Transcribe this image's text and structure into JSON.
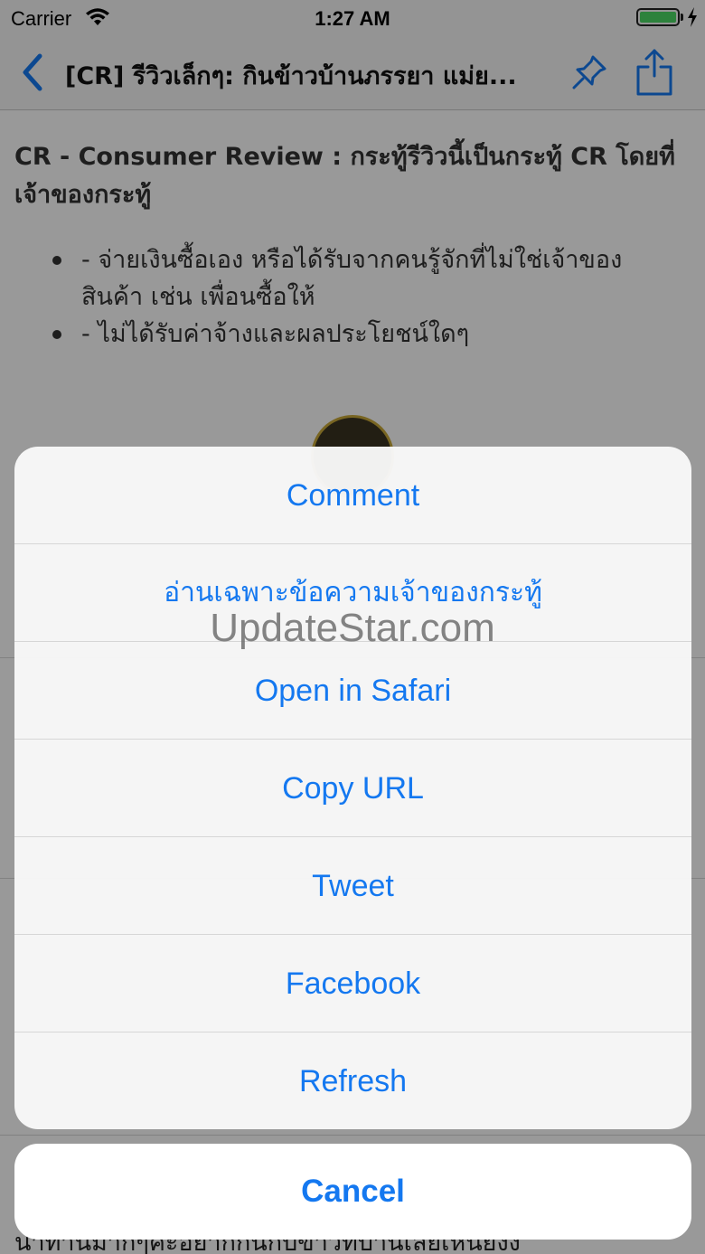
{
  "status_bar": {
    "carrier": "Carrier",
    "time": "1:27 AM",
    "battery_color": "#4cd964"
  },
  "nav": {
    "title": "[CR] รีวิวเล็กๆ: กินข้าวบ้านภรรยา แม่ย...",
    "back_icon": "chevron-left-icon",
    "pin_icon": "pin-icon",
    "share_icon": "share-icon",
    "accent": "#1478f0"
  },
  "content": {
    "intro": "CR - Consumer Review : กระทู้รีวิวนี้เป็นกระทู้ CR โดยที่เจ้าของกระทู้",
    "bullets": [
      "- จ่ายเงินซื้อเอง หรือได้รับจากคนรู้จักที่ไม่ใช่เจ้าของสินค้า เช่น เพื่อนซื้อให้",
      "- ไม่ได้รับค่าจ้างและผลประโยชน์ใดๆ"
    ],
    "bottom_text": "น่าทานมากๆคะอยากกินกับข้าวที่บ้านเลยเห็นยังง"
  },
  "action_sheet": {
    "actions": [
      {
        "label": "Comment"
      },
      {
        "label": "อ่านเฉพาะข้อความเจ้าของกระทู้"
      },
      {
        "label": "Open in Safari"
      },
      {
        "label": "Copy URL"
      },
      {
        "label": "Tweet"
      },
      {
        "label": "Facebook"
      },
      {
        "label": "Refresh"
      }
    ],
    "cancel_label": "Cancel",
    "action_color": "#1478f0"
  },
  "watermark": "UpdateStar.com"
}
